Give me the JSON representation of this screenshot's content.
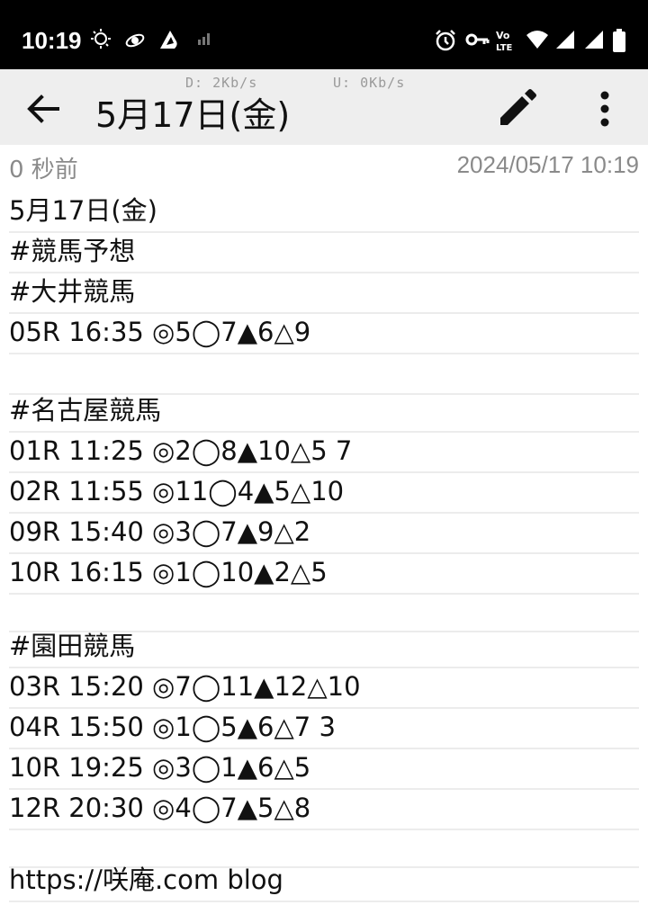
{
  "status_bar": {
    "time": "10:19",
    "left_icons": [
      "brightness-auto-icon",
      "satellite-icon",
      "app-notification-icon",
      "signal-weak-icon"
    ],
    "right_icons": [
      "alarm-icon",
      "vpn-key-icon",
      "volte-icon",
      "wifi-icon",
      "cell-signal-icon",
      "cell-signal-icon",
      "battery-icon"
    ]
  },
  "net_speed": {
    "download": "D: 2Kb/s",
    "upload": "U: 0Kb/s"
  },
  "app_bar": {
    "title": "5月17日(金)"
  },
  "meta": {
    "relative_time": "0 秒前",
    "timestamp": "2024/05/17 10:19"
  },
  "note_lines": [
    "5月17日(金)",
    "#競馬予想",
    "#大井競馬",
    "05R 16:35 ◎5◯7▲6△9",
    "",
    "#名古屋競馬",
    "01R 11:25 ◎2◯8▲10△5 7",
    "02R 11:55 ◎11◯4▲5△10",
    "09R 15:40 ◎3◯7▲9△2",
    "10R 16:15 ◎1◯10▲2△5",
    "",
    "#園田競馬",
    "03R 15:20 ◎7◯11▲12△10",
    "04R 15:50 ◎1◯5▲6△7 3",
    "10R 19:25 ◎3◯1▲6△5",
    "12R 20:30 ◎4◯7▲5△8",
    "",
    "https://咲庵.com blog"
  ]
}
